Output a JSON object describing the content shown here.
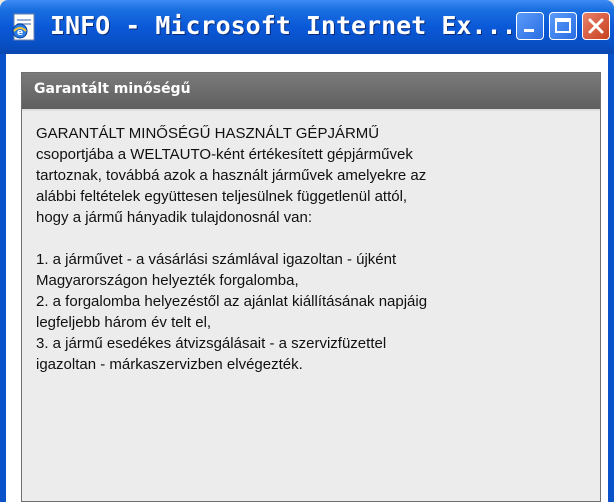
{
  "window": {
    "title": "INFO - Microsoft Internet Ex...",
    "icon": "ie-page-icon",
    "controls": {
      "minimize": "minimize-icon",
      "maximize": "maximize-icon",
      "close": "close-icon"
    },
    "colors": {
      "titlebar": "#0a58d8",
      "close_button": "#c8401e",
      "panel_header": "#6a6a6a",
      "panel_background": "#ececec"
    }
  },
  "panel": {
    "header": "Garantált minőségű",
    "lines": [
      "GARANTÁLT MINŐSÉGŰ HASZNÁLT GÉPJÁRMŰ",
      "csoportjába a WELTAUTO-ként értékesített gépjárművek",
      "tartoznak, továbbá azok a használt járművek amelyekre az",
      "alábbi feltételek együttesen teljesülnek függetlenül attól,",
      "hogy a jármű hányadik tulajdonosnál van:",
      "",
      "1. a járművet - a vásárlási számlával igazoltan - újként",
      "Magyarországon helyezték forgalomba,",
      "2. a forgalomba helyezéstől az ajánlat kiállításának napjáig",
      "legfeljebb három év telt el,",
      "3. a jármű esedékes átvizsgálásait - a szervizfüzettel",
      "igazoltan - márkaszervizben elvégezték."
    ]
  }
}
